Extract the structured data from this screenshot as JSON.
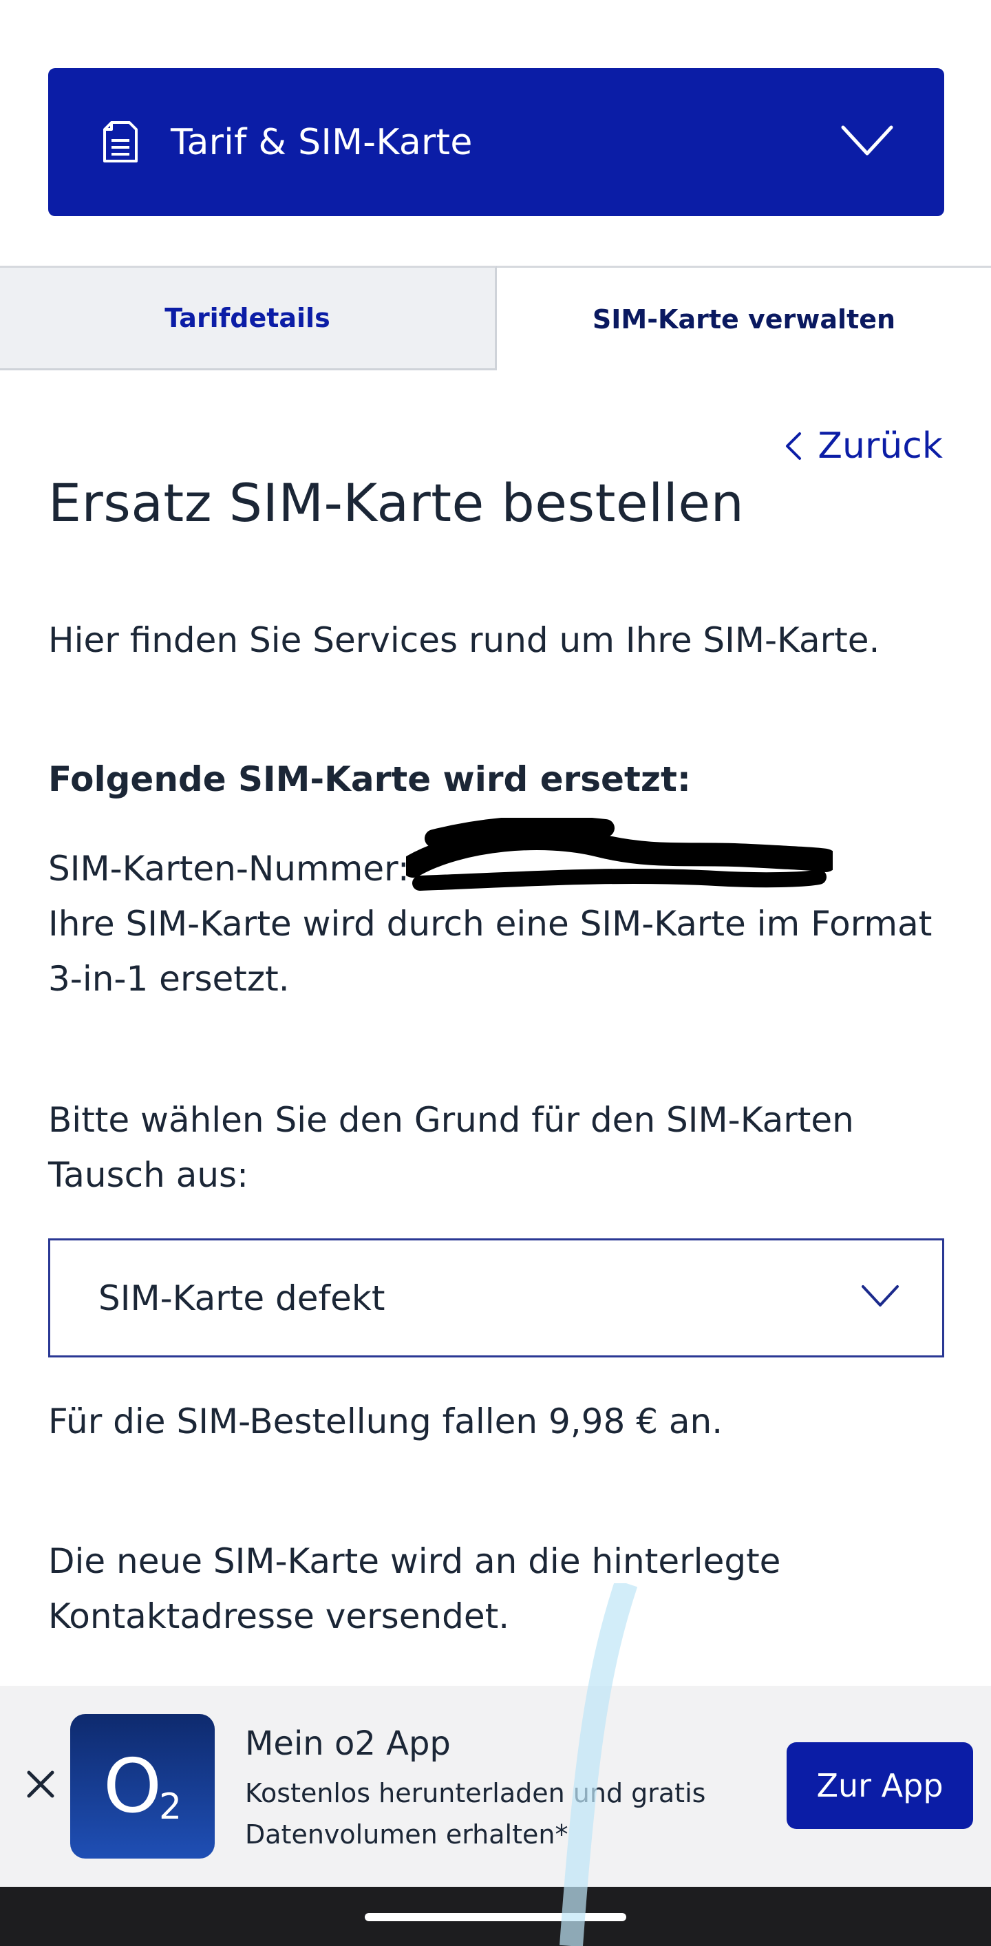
{
  "header": {
    "title": "Tarif & SIM-Karte",
    "icon": "document-icon",
    "toggle_icon": "chevron-down-icon"
  },
  "tabs": [
    {
      "label": "Tarifdetails",
      "active": false
    },
    {
      "label": "SIM-Karte verwalten",
      "active": true
    }
  ],
  "back": {
    "label": "Zurück",
    "icon": "chevron-left-icon"
  },
  "main": {
    "title": "Ersatz SIM-Karte bestellen",
    "intro": "Hier finden Sie Services rund um Ihre SIM-Karte.",
    "replaced_heading": "Folgende SIM-Karte wird ersetzt:",
    "sim_number_label": "SIM-Karten-Nummer:",
    "format_text": "Ihre SIM-Karte wird durch eine SIM-Karte im Format 3-in-1 ersetzt.",
    "reason_prompt": "Bitte wählen Sie den Grund für den SIM-Karten Tausch aus:",
    "reason_select": {
      "value": "SIM-Karte defekt"
    },
    "fee_text": "Für die SIM-Bestellung fallen 9,98 € an.",
    "shipping_text": "Die neue SIM-Karte wird an die hinterlegte Kontaktadresse versendet."
  },
  "app_banner": {
    "app_name": "Mein o2 App",
    "description": "Kostenlos herunterladen und gratis Datenvolumen erhalten*",
    "cta_label": "Zur App",
    "logo_o": "O",
    "logo_sub": "2"
  },
  "colors": {
    "brand": "#0b1da6",
    "text": "#1b2636",
    "tab_inactive_bg": "#eef0f3",
    "banner_bg": "#f2f2f3"
  }
}
